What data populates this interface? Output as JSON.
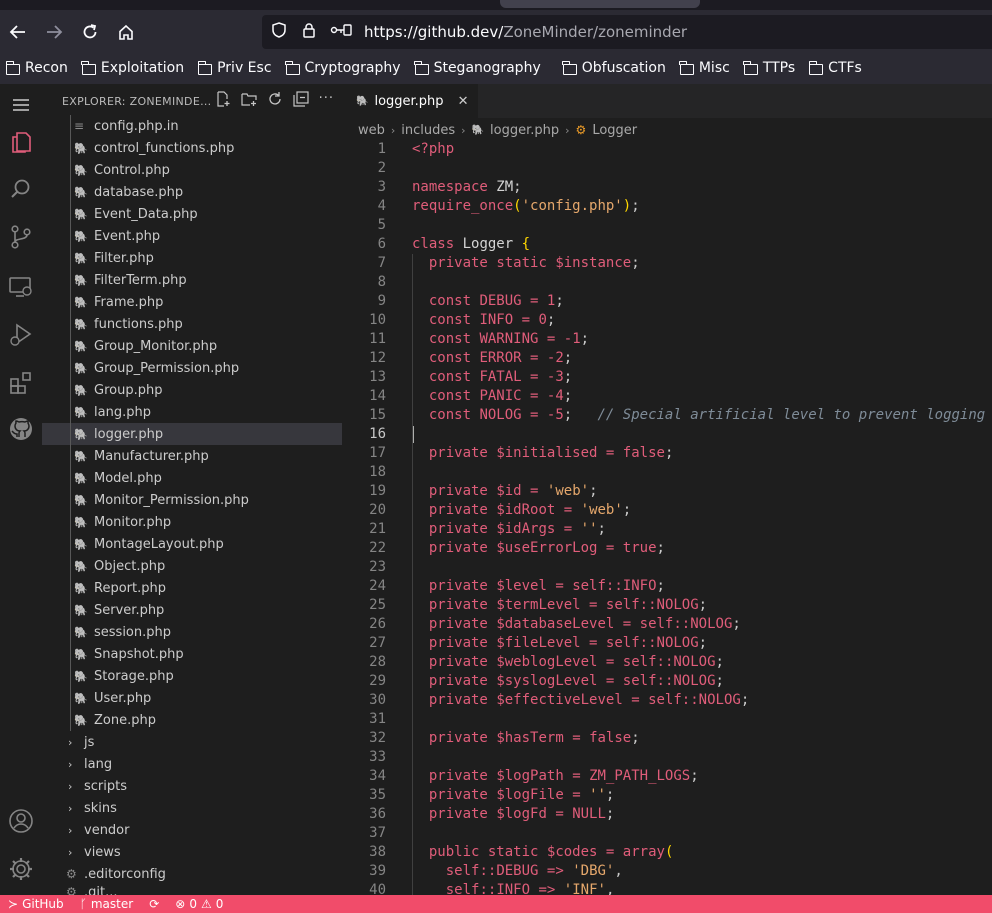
{
  "browser": {
    "url_host": "https://github.dev/",
    "url_path": "ZoneMinder/zoneminder",
    "nav_icons": [
      "back-icon",
      "forward-icon",
      "reload-icon",
      "home-icon"
    ]
  },
  "bookmarks": [
    "Recon",
    "Exploitation",
    "Priv Esc",
    "Cryptography",
    "Steganography",
    "Obfuscation",
    "Misc",
    "TTPs",
    "CTFs"
  ],
  "sidebar": {
    "title": "EXPLORER: ZONEMINDE...",
    "files": [
      {
        "name": "config.php.in",
        "type": "text"
      },
      {
        "name": "control_functions.php",
        "type": "php"
      },
      {
        "name": "Control.php",
        "type": "php"
      },
      {
        "name": "database.php",
        "type": "php"
      },
      {
        "name": "Event_Data.php",
        "type": "php"
      },
      {
        "name": "Event.php",
        "type": "php"
      },
      {
        "name": "Filter.php",
        "type": "php"
      },
      {
        "name": "FilterTerm.php",
        "type": "php"
      },
      {
        "name": "Frame.php",
        "type": "php"
      },
      {
        "name": "functions.php",
        "type": "php"
      },
      {
        "name": "Group_Monitor.php",
        "type": "php"
      },
      {
        "name": "Group_Permission.php",
        "type": "php"
      },
      {
        "name": "Group.php",
        "type": "php"
      },
      {
        "name": "lang.php",
        "type": "php"
      },
      {
        "name": "logger.php",
        "type": "php",
        "selected": true
      },
      {
        "name": "Manufacturer.php",
        "type": "php"
      },
      {
        "name": "Model.php",
        "type": "php"
      },
      {
        "name": "Monitor_Permission.php",
        "type": "php"
      },
      {
        "name": "Monitor.php",
        "type": "php"
      },
      {
        "name": "MontageLayout.php",
        "type": "php"
      },
      {
        "name": "Object.php",
        "type": "php"
      },
      {
        "name": "Report.php",
        "type": "php"
      },
      {
        "name": "Server.php",
        "type": "php"
      },
      {
        "name": "session.php",
        "type": "php"
      },
      {
        "name": "Snapshot.php",
        "type": "php"
      },
      {
        "name": "Storage.php",
        "type": "php"
      },
      {
        "name": "User.php",
        "type": "php"
      },
      {
        "name": "Zone.php",
        "type": "php"
      }
    ],
    "folders": [
      "js",
      "lang",
      "scripts",
      "skins",
      "vendor",
      "views"
    ],
    "extra": ".editorconfig",
    "partial": ".git..."
  },
  "editor": {
    "tab_label": "logger.php",
    "breadcrumb": [
      "web",
      "includes",
      "logger.php",
      "Logger"
    ],
    "lines": [
      "<?php",
      "",
      "namespace ZM;",
      "require_once('config.php');",
      "",
      "class Logger {",
      "  private static $instance;",
      "",
      "  const DEBUG = 1;",
      "  const INFO = 0;",
      "  const WARNING = -1;",
      "  const ERROR = -2;",
      "  const FATAL = -3;",
      "  const PANIC = -4;",
      "  const NOLOG = -5;   // Special artificial level to prevent logging",
      "",
      "  private $initialised = false;",
      "",
      "  private $id = 'web';",
      "  private $idRoot = 'web';",
      "  private $idArgs = '';",
      "  private $useErrorLog = true;",
      "",
      "  private $level = self::INFO;",
      "  private $termLevel = self::NOLOG;",
      "  private $databaseLevel = self::NOLOG;",
      "  private $fileLevel = self::NOLOG;",
      "  private $weblogLevel = self::NOLOG;",
      "  private $syslogLevel = self::NOLOG;",
      "  private $effectiveLevel = self::NOLOG;",
      "",
      "  private $hasTerm = false;",
      "",
      "  private $logPath = ZM_PATH_LOGS;",
      "  private $logFile = '';",
      "  private $logFd = NULL;",
      "",
      "  public static $codes = array(",
      "    self::DEBUG => 'DBG',",
      "    self::INFO => 'INF',"
    ],
    "current_line": 16
  },
  "statusbar": {
    "remote": "GitHub",
    "branch": "master",
    "problems": "0",
    "warnings": "0"
  }
}
